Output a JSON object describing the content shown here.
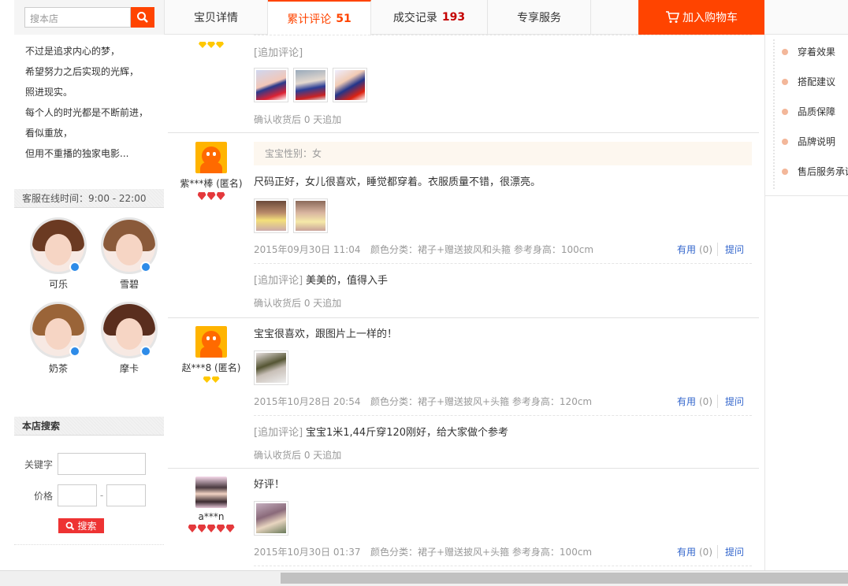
{
  "nav": {
    "search_placeholder": "搜本店",
    "tabs": [
      {
        "label": "宝贝详情",
        "count": ""
      },
      {
        "label": "累计评论",
        "count": "51"
      },
      {
        "label": "成交记录",
        "count": "193"
      },
      {
        "label": "专享服务",
        "count": ""
      }
    ],
    "cart_label": "加入购物车"
  },
  "sidebar": {
    "poem": [
      "不过是追求内心的梦，",
      "希望努力之后实现的光辉，",
      "照进现实。",
      "每个人的时光都是不断前进，",
      "看似重放，",
      "但用不重播的独家电影..."
    ],
    "service_title": "客服在线时间：9:00 - 22:00",
    "agents": [
      {
        "name": "可乐",
        "hair": "#6b3a22"
      },
      {
        "name": "雪碧",
        "hair": "#8a5a3a"
      },
      {
        "name": "奶茶",
        "hair": "#9a6438"
      },
      {
        "name": "摩卡",
        "hair": "#5a2e1e"
      }
    ],
    "shop_search": {
      "title": "本店搜索",
      "keyword_label": "关键字",
      "price_label": "价格",
      "price_sep": "-",
      "button_label": "搜索"
    }
  },
  "reviews": {
    "first_partial": {
      "append_label": "[追加评论]",
      "footnote": "确认收货后 0 天追加"
    },
    "items": [
      {
        "user": "紫***棒 (匿名)",
        "attr": "宝宝性别：女",
        "text": "尺码正好，女儿很喜欢，睡觉都穿着。衣服质量不错，很漂亮。",
        "date": "2015年09月30日 11:04",
        "sku": "颜色分类：裙子+赠送披风和头箍   参考身高：100cm",
        "useful": "有用",
        "useful_count": "(0)",
        "ask": "提问",
        "append_label": "[追加评论]",
        "append_text": "美美的，值得入手",
        "footnote": "确认收货后 0 天追加"
      },
      {
        "user": "赵***8 (匿名)",
        "text": "宝宝很喜欢，跟图片上一样的！",
        "date": "2015年10月28日 20:54",
        "sku": "颜色分类：裙子+赠送披风+头箍   参考身高：120cm",
        "useful": "有用",
        "useful_count": "(0)",
        "ask": "提问",
        "append_label": "[追加评论]",
        "append_text": "宝宝1米1,44斤穿120刚好，给大家做个参考",
        "footnote": "确认收货后 0 天追加"
      },
      {
        "user": "a***n",
        "text": "好评！",
        "date": "2015年10月30日 01:37",
        "sku": "颜色分类：裙子+赠送披风+头箍   参考身高：100cm",
        "useful": "有用",
        "useful_count": "(0)",
        "ask": "提问"
      }
    ]
  },
  "right_nav": [
    "穿着效果",
    "搭配建议",
    "品质保障",
    "品牌说明",
    "售后服务承诺"
  ],
  "colors": {
    "accent": "#ff4400",
    "link": "#3366cc"
  }
}
